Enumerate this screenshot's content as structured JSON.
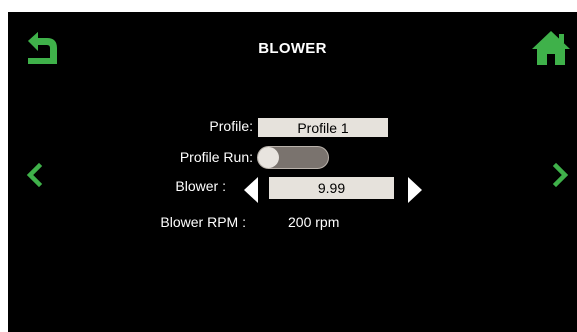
{
  "header": {
    "title": "BLOWER",
    "back_icon": "back-arrow-icon",
    "home_icon": "home-icon"
  },
  "navigation": {
    "prev_icon": "chevron-left-icon",
    "next_icon": "chevron-right-icon"
  },
  "form": {
    "profile_label": "Profile:",
    "profile_value": "Profile 1",
    "profile_run_label": "Profile Run:",
    "profile_run_state": "off",
    "blower_label": "Blower :",
    "blower_value": "9.99",
    "blower_rpm_label": "Blower RPM :",
    "blower_rpm_value": "200 rpm"
  },
  "colors": {
    "background": "#000000",
    "accent_green": "#3fb14a",
    "field_bg": "#e6e2dc",
    "toggle_track": "#7a736e",
    "text": "#ffffff"
  }
}
